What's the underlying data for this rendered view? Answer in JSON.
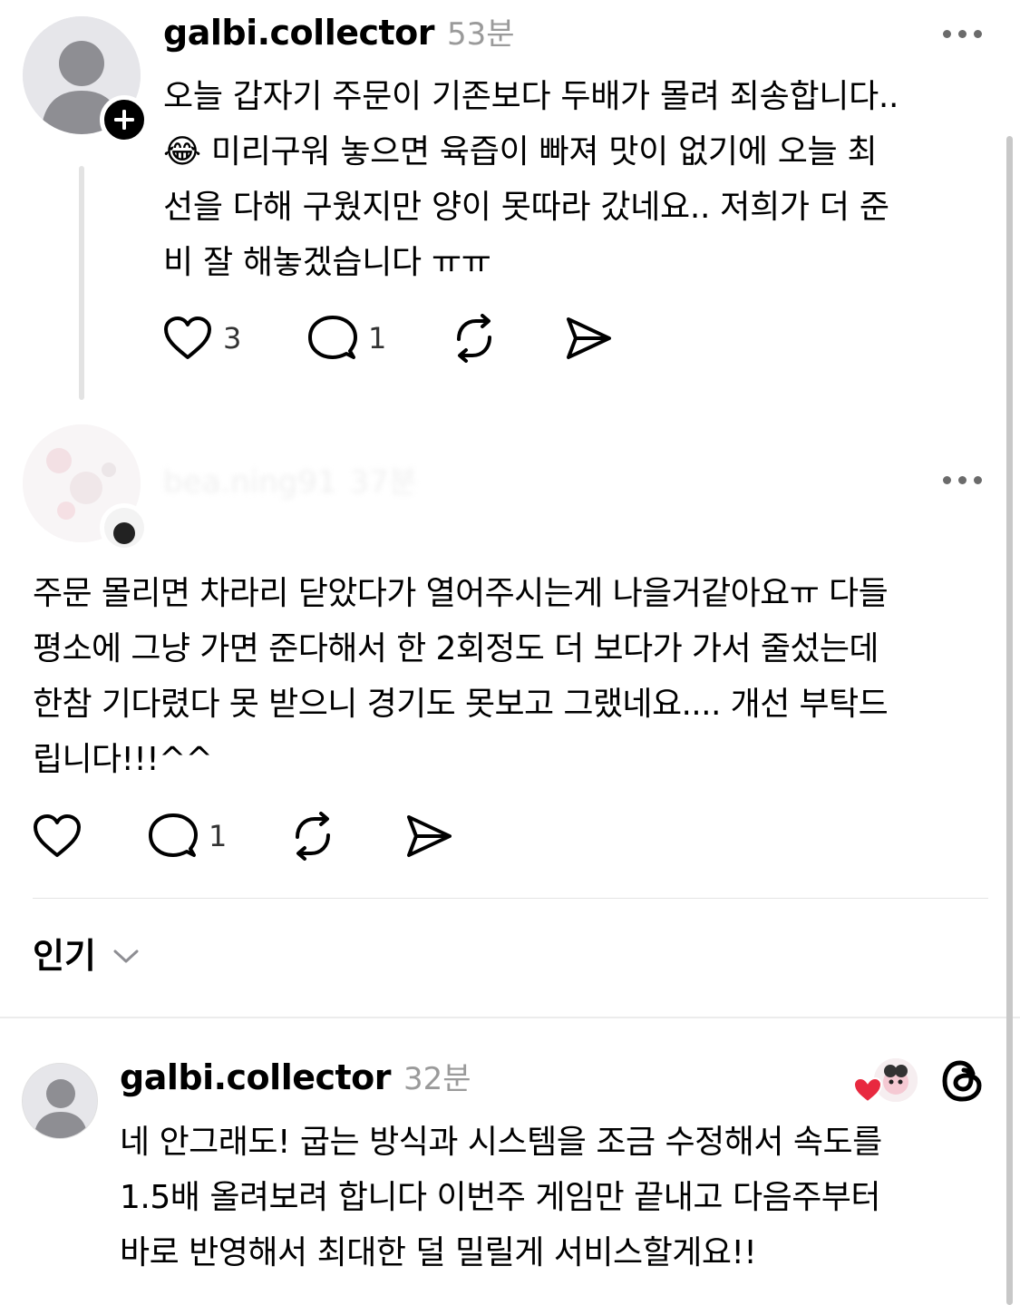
{
  "posts": [
    {
      "username": "galbi.collector",
      "time": "53분",
      "lines": [
        "오늘 갑자기 주문이 기존보다 두배가 몰려 죄송합니다..",
        "😂 미리구워 놓으면 육즙이 빠져 맛이 없기에 오늘 최",
        "선을 다해 구웠지만 양이 못따라 갔네요.. 저희가 더 준",
        "비 잘 해놓겠습니다 ㅠㅠ"
      ],
      "likes": "3",
      "replies": "1"
    },
    {
      "username": "bea.ning91",
      "time": "37분",
      "lines": [
        "주문 몰리면 차라리 닫았다가 열어주시는게 나을거같아요ㅠ 다들",
        "평소에 그냥 가면 준다해서 한 2회정도 더 보다가 가서 줄섰는데",
        "한참 기다렸다 못 받으니 경기도 못보고 그랬네요.... 개선 부탁드",
        "립니다!!!^^"
      ],
      "likes": "",
      "replies": "1"
    }
  ],
  "sort": {
    "label": "인기"
  },
  "reply": {
    "username": "galbi.collector",
    "time": "32분",
    "lines": [
      "네 안그래도! 굽는 방식과 시스템을 조금 수정해서 속도를",
      "1.5배 올려보려 합니다 이번주 게임만 끝내고 다음주부터",
      "바로 반영해서 최대한 덜 밀릴게 서비스할게요!!"
    ]
  },
  "colors": {
    "text": "#000000",
    "muted": "#9a9a9a",
    "avatar_bg": "#e6e6ea",
    "avatar_fg": "#8e8e93",
    "heart_red": "#e8293f"
  }
}
